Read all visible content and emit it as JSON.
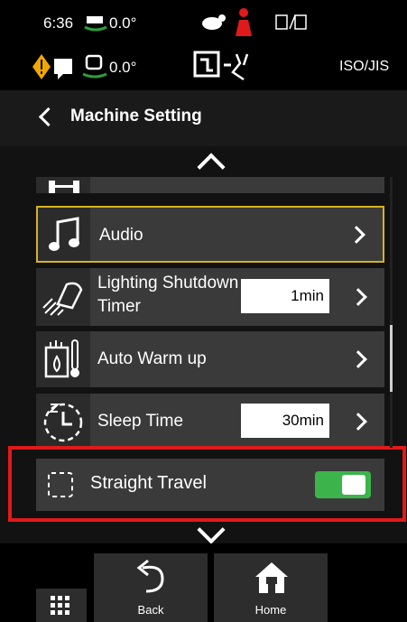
{
  "status": {
    "time": "6:36",
    "angle1": "0.0°",
    "angle2": "0.0°",
    "pattern": "ISO/JIS"
  },
  "header": {
    "title": "Machine Setting"
  },
  "items": [
    {
      "label": "Audio"
    },
    {
      "label_line1": "Lighting Shutdown",
      "label_line2": "Timer",
      "value": "1min"
    },
    {
      "label": "Auto Warm up"
    },
    {
      "label": "Sleep Time",
      "value": "30min"
    },
    {
      "label": "Straight Travel",
      "toggle": "on"
    }
  ],
  "nav": {
    "back_label": "Back",
    "home_label": "Home"
  },
  "colors": {
    "selection_border": "#d7b21e",
    "highlight": "#e01a1a",
    "toggle_on": "#3cb44b"
  }
}
